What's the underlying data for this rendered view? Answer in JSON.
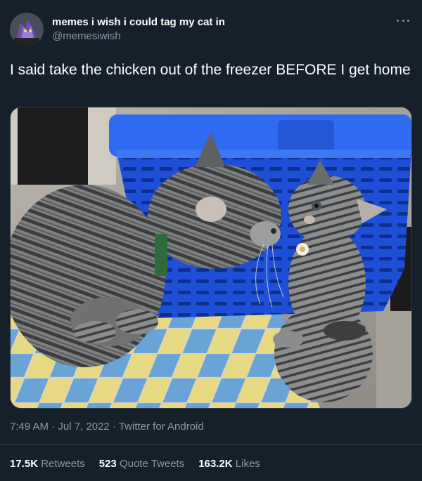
{
  "author": {
    "display_name": "memes i wish i could tag my cat in",
    "handle": "@memesiwish",
    "avatar_icon": "avatar-image"
  },
  "menu": {
    "icon": "more-options-icon"
  },
  "tweet": {
    "text": "I said take the chicken out of the freezer BEFORE I get home"
  },
  "media": {
    "icon": "photo-two-cats-blue-basket"
  },
  "meta": {
    "time": "7:49 AM",
    "sep1": " · ",
    "date": "Jul 7, 2022",
    "sep2": " · ",
    "client": "Twitter for Android"
  },
  "stats": {
    "retweets_count": "17.5K",
    "retweets_label": "Retweets",
    "quotes_count": "523",
    "quotes_label": "Quote Tweets",
    "likes_count": "163.2K",
    "likes_label": "Likes"
  },
  "colors": {
    "background": "#15202b",
    "text_primary": "#ffffff",
    "text_secondary": "#8b98a5",
    "divider": "#38444d"
  }
}
